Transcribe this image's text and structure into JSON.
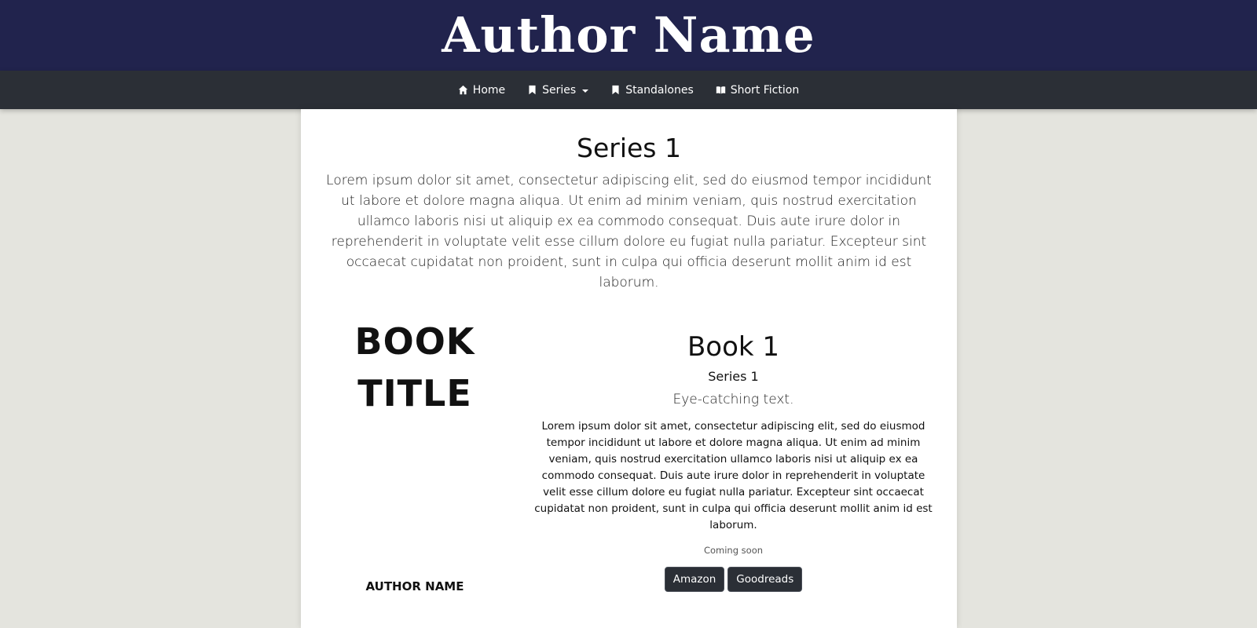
{
  "header": {
    "title": "Author Name"
  },
  "nav": {
    "items": [
      {
        "label": "Home",
        "icon": "home-icon"
      },
      {
        "label": "Series",
        "icon": "bookmark-icon",
        "dropdown": true
      },
      {
        "label": "Standalones",
        "icon": "bookmark-icon"
      },
      {
        "label": "Short Fiction",
        "icon": "book-open-icon"
      }
    ]
  },
  "series": {
    "title": "Series 1",
    "description": "Lorem ipsum dolor sit amet, consectetur adipiscing elit, sed do eiusmod tempor incididunt ut labore et dolore magna aliqua. Ut enim ad minim veniam, quis nostrud exercitation ullamco laboris nisi ut aliquip ex ea commodo consequat. Duis aute irure dolor in reprehenderit in voluptate velit esse cillum dolore eu fugiat nulla pariatur. Excepteur sint occaecat cupidatat non proident, sunt in culpa qui officia deserunt mollit anim id est laborum."
  },
  "book": {
    "cover": {
      "title_line1": "BOOK",
      "title_line2": "TITLE",
      "author": "AUTHOR NAME"
    },
    "title": "Book 1",
    "series": "Series 1",
    "tagline": "Eye-catching text.",
    "blurb": "Lorem ipsum dolor sit amet, consectetur adipiscing elit, sed do eiusmod tempor incididunt ut labore et dolore magna aliqua. Ut enim ad minim veniam, quis nostrud exercitation ullamco laboris nisi ut aliquip ex ea commodo consequat. Duis aute irure dolor in reprehenderit in voluptate velit esse cillum dolore eu fugiat nulla pariatur. Excepteur sint occaecat cupidatat non proident, sunt in culpa qui officia deserunt mollit anim id est laborum.",
    "status": "Coming soon",
    "buttons": {
      "amazon": "Amazon",
      "goodreads": "Goodreads"
    }
  },
  "colors": {
    "header_bg": "#21234d",
    "nav_bg": "#2b2f36",
    "page_bg": "#e4e4de"
  }
}
